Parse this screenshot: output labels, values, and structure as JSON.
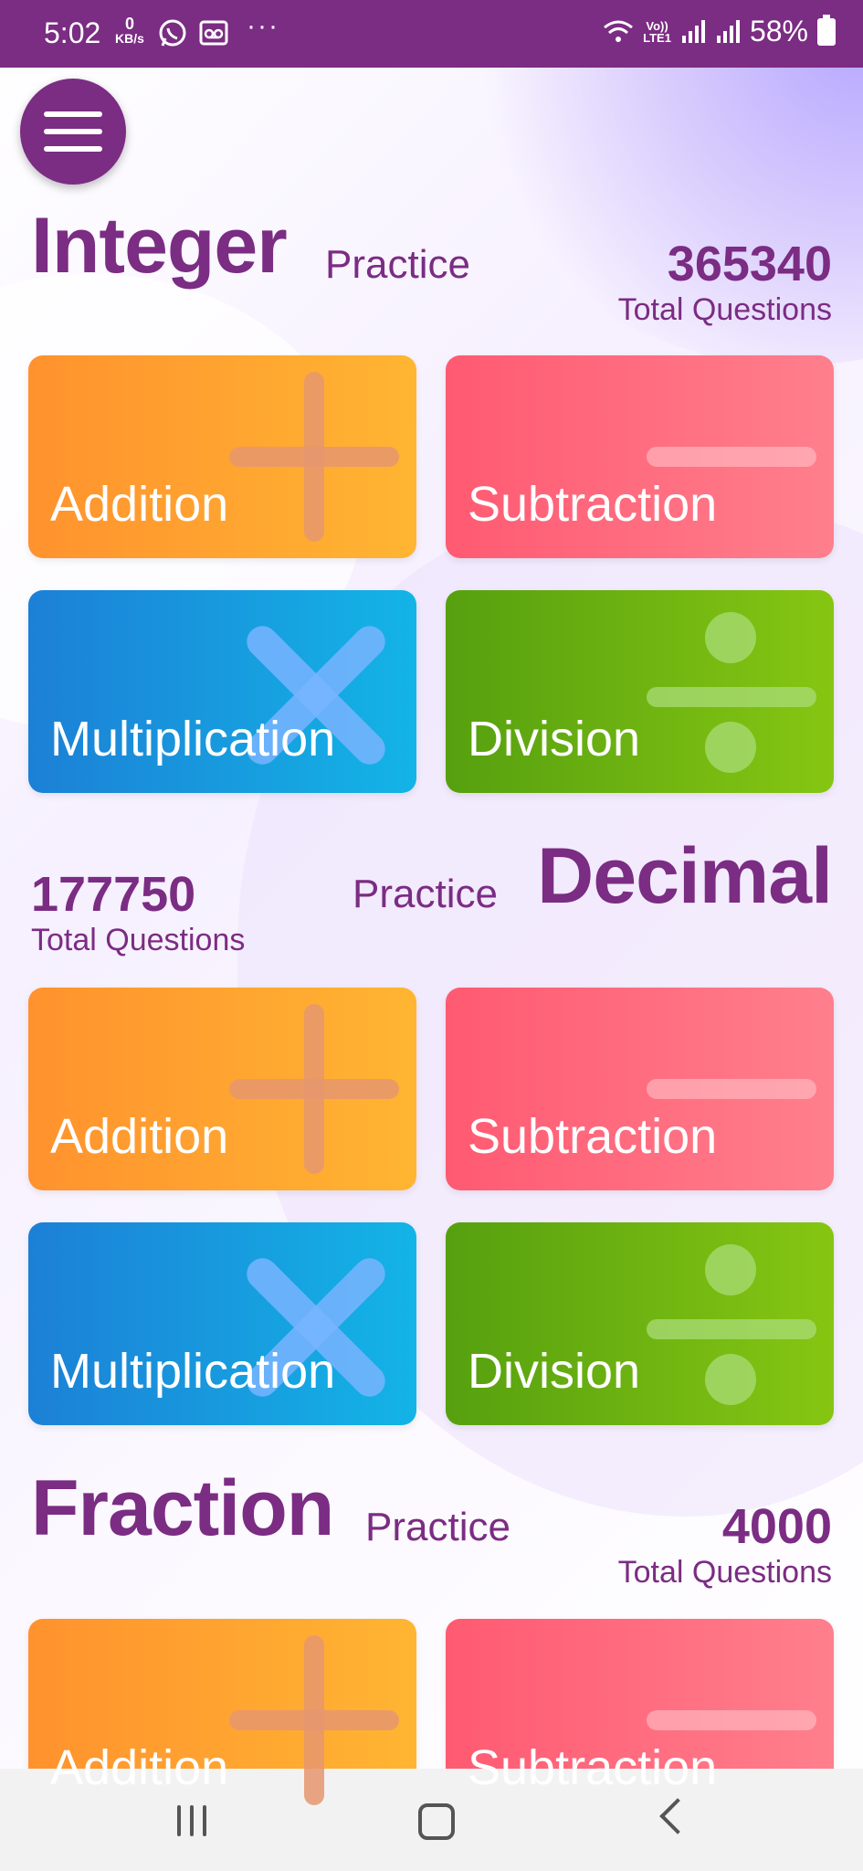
{
  "status_bar": {
    "time": "5:02",
    "data_rate_value": "0",
    "data_rate_unit": "KB/s",
    "more": "···",
    "volte": "Vo))",
    "lte": "LTE1",
    "battery": "58%",
    "icons": [
      "whatsapp-icon",
      "voicemail-icon",
      "wifi-icon",
      "signal-icon",
      "battery-icon"
    ]
  },
  "menu": {
    "icon": "hamburger-menu-icon"
  },
  "sections": [
    {
      "title": "Integer",
      "subtitle": "Practice",
      "count": "365340",
      "count_label": "Total Questions",
      "cards": [
        {
          "label": "Addition",
          "color": "#ff922e",
          "symbol": "plus"
        },
        {
          "label": "Subtraction",
          "color": "#ff5a72",
          "symbol": "minus"
        },
        {
          "label": "Multiplication",
          "color": "#1c80d6",
          "symbol": "times"
        },
        {
          "label": "Division",
          "color": "#56a010",
          "symbol": "divide"
        }
      ]
    },
    {
      "title": "Decimal",
      "subtitle": "Practice",
      "count": "177750",
      "count_label": "Total Questions",
      "cards": [
        {
          "label": "Addition",
          "color": "#ff922e",
          "symbol": "plus"
        },
        {
          "label": "Subtraction",
          "color": "#ff5a72",
          "symbol": "minus"
        },
        {
          "label": "Multiplication",
          "color": "#1c80d6",
          "symbol": "times"
        },
        {
          "label": "Division",
          "color": "#56a010",
          "symbol": "divide"
        }
      ]
    },
    {
      "title": "Fraction",
      "subtitle": "Practice",
      "count": "4000",
      "count_label": "Total Questions",
      "cards": [
        {
          "label": "Addition",
          "color": "#ff922e",
          "symbol": "plus"
        },
        {
          "label": "Subtraction",
          "color": "#ff5a72",
          "symbol": "minus"
        }
      ]
    }
  ],
  "colors": {
    "brand": "#7b2c83",
    "status_bar": "#7b2c83"
  },
  "nav_bar": {
    "icons": [
      "recents-icon",
      "home-icon",
      "back-icon"
    ]
  }
}
